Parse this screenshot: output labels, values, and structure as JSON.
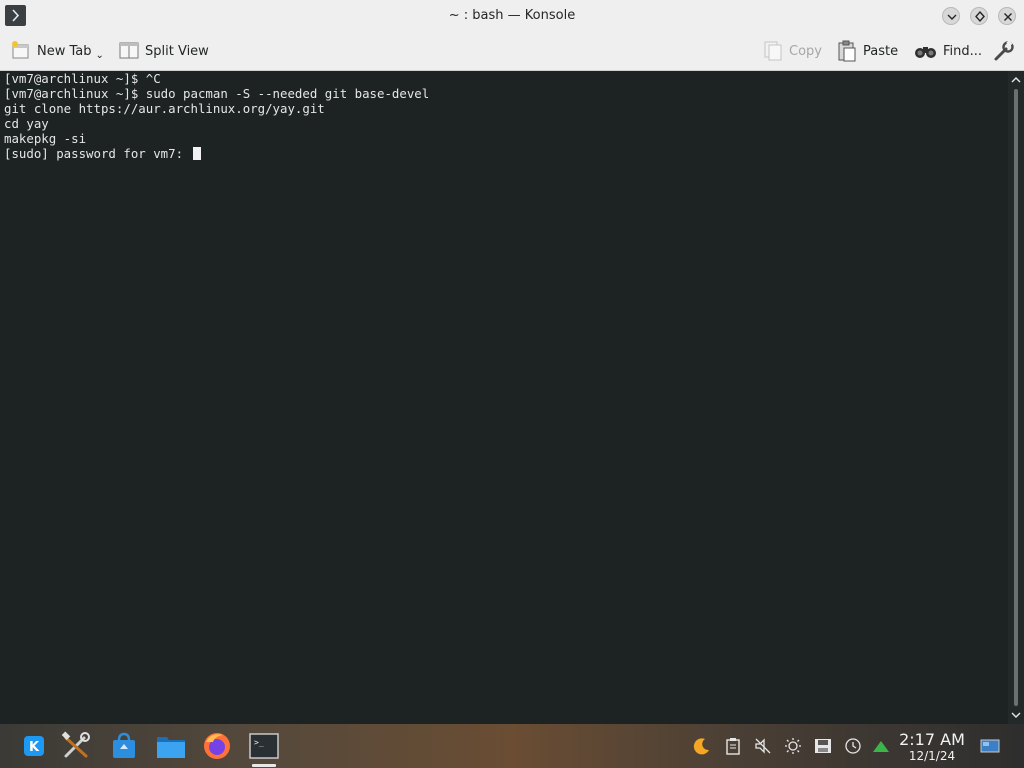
{
  "window": {
    "title": "~ : bash — Konsole"
  },
  "toolbar": {
    "new_tab_label": "New Tab",
    "split_view_label": "Split View",
    "copy_label": "Copy",
    "paste_label": "Paste",
    "find_label": "Find..."
  },
  "terminal": {
    "lines": [
      "[vm7@archlinux ~]$ ^C",
      "[vm7@archlinux ~]$ sudo pacman -S --needed git base-devel",
      "git clone https://aur.archlinux.org/yay.git",
      "cd yay",
      "makepkg -si",
      "[sudo] password for vm7: "
    ]
  },
  "taskbar": {
    "apps": [
      "kde-launcher-icon",
      "system-settings-icon",
      "discover-icon",
      "dolphin-icon",
      "firefox-icon",
      "konsole-icon"
    ],
    "tray": [
      "night-color-icon",
      "clipboard-icon",
      "audio-muted-icon",
      "brightness-icon",
      "disk-icon",
      "update-icon",
      "network-icon"
    ]
  },
  "clock": {
    "time": "2:17 AM",
    "date": "12/1/24"
  },
  "colors": {
    "terminal_bg": "#1d2322",
    "terminal_fg": "#e6e6e6",
    "titlebar_bg": "#efefef"
  }
}
